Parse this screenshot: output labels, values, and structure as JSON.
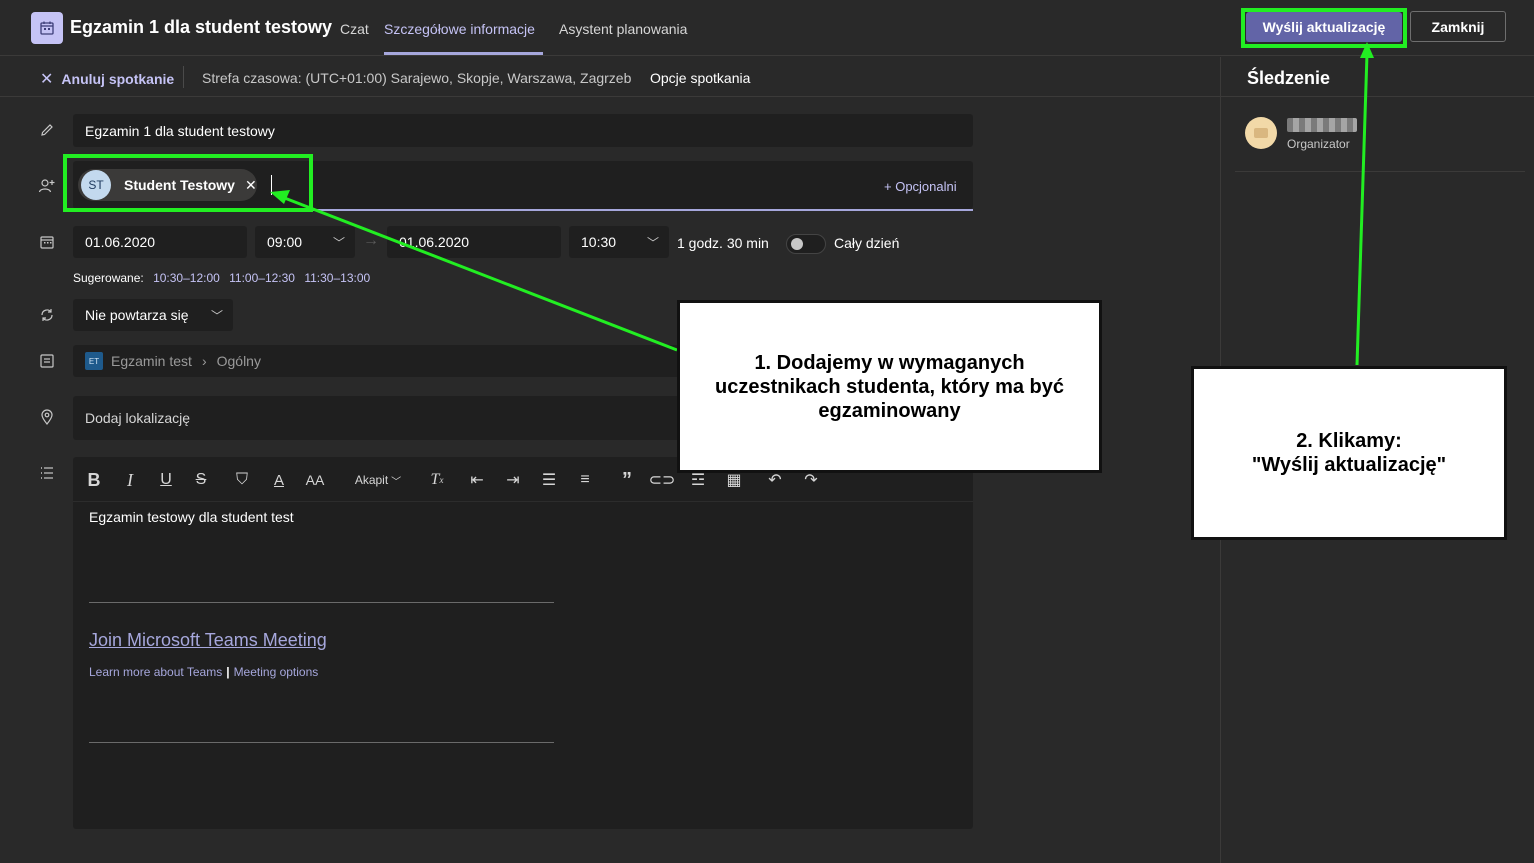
{
  "header": {
    "title": "Egzamin 1 dla student testowy",
    "tabs": [
      {
        "label": "Czat"
      },
      {
        "label": "Szczegółowe informacje"
      },
      {
        "label": "Asystent planowania"
      }
    ],
    "send_update_label": "Wyślij aktualizację",
    "close_label": "Zamknij"
  },
  "subbar": {
    "cancel_label": "Anuluj spotkanie",
    "timezone": "Strefa czasowa: (UTC+01:00) Sarajewo, Skopje, Warszawa, Zagrzeb",
    "meeting_options": "Opcje spotkania"
  },
  "form": {
    "title_value": "Egzamin 1 dla student testowy",
    "attendee": {
      "initials": "ST",
      "name": "Student Testowy"
    },
    "optional_label": "+ Opcjonalni",
    "start_date": "01.06.2020",
    "start_time": "09:00",
    "end_date": "01.06.2020",
    "end_time": "10:30",
    "duration": "1 godz. 30 min",
    "all_day_label": "Cały dzień",
    "suggested_label": "Sugerowane:",
    "suggested_slots": [
      "10:30–12:00",
      "11:00–12:30",
      "11:30–13:00"
    ],
    "repeat_value": "Nie powtarza się",
    "channel": {
      "team": "Egzamin test",
      "channel": "Ogólny",
      "icon_label": "ET"
    },
    "location_placeholder": "Dodaj lokalizację"
  },
  "editor": {
    "paragraph_label": "Akapit",
    "body_text": "Egzamin testowy dla student test",
    "join_link": "Join Microsoft Teams Meeting",
    "learn_more": "Learn more about Teams",
    "learn_sep": "|",
    "meeting_options": "Meeting options"
  },
  "tracking": {
    "title": "Śledzenie",
    "organizer_role": "Organizator"
  },
  "callouts": [
    {
      "line1": "1. Dodajemy w wymaganych",
      "line2": "uczestnikach studenta, który ma być",
      "line3": "egzaminowany"
    },
    {
      "line1": "2. Klikamy:",
      "line2": "\"Wyślij aktualizację\""
    }
  ],
  "colors": {
    "accent": "#6264a7",
    "highlight": "#22ee22",
    "link": "#a6a7dc"
  }
}
